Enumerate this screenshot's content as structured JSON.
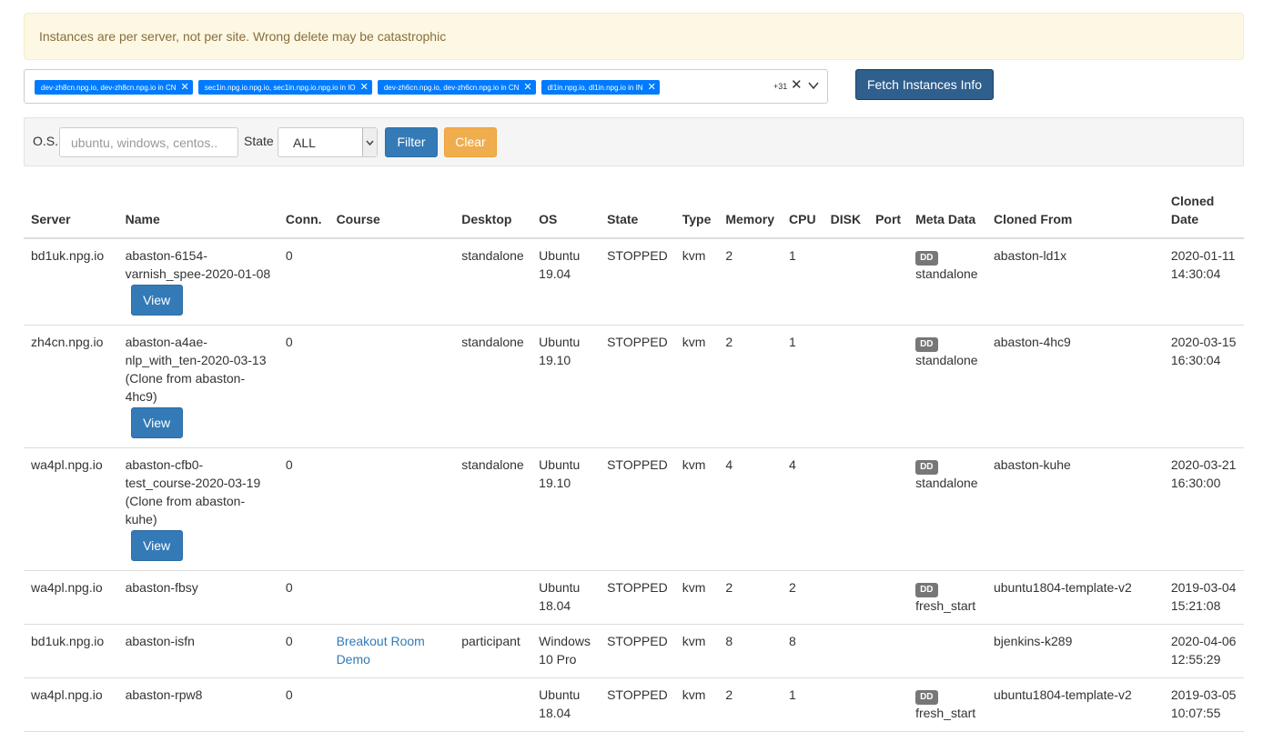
{
  "alert": {
    "warning_text": "Instances are per server, not per site. Wrong delete may be catastrophic"
  },
  "site_selector": {
    "tags": [
      "dev-zh8cn.npg.io, dev-zh8cn.npg.io in CN",
      "sec1in.npg.io.npg.io, sec1in.npg.io.npg.io in IO",
      "dev-zh6cn.npg.io, dev-zh6cn.npg.io in CN",
      "dl1in.npg.io, dl1in.npg.io in IN"
    ],
    "more_count": "+31",
    "remove_icon": "close-icon",
    "dropdown_icon": "chevron-down-icon"
  },
  "fetch_button_label": "Fetch Instances Info",
  "filters": {
    "os_label": "O.S.",
    "os_placeholder": "ubuntu, windows, centos..",
    "state_label": "State",
    "state_value": "ALL",
    "filter_label": "Filter",
    "clear_label": "Clear"
  },
  "table": {
    "headers": {
      "server": "Server",
      "name": "Name",
      "conn": "Conn.",
      "course": "Course",
      "desktop": "Desktop",
      "os": "OS",
      "state": "State",
      "type": "Type",
      "memory": "Memory",
      "cpu": "CPU",
      "disk": "DISK",
      "port": "Port",
      "meta": "Meta Data",
      "cloned_from": "Cloned From",
      "cloned_date": "Cloned Date"
    },
    "view_label": "View",
    "rows": [
      {
        "server": "bd1uk.npg.io",
        "name": "abaston-6154-varnish_spee-2020-01-08",
        "conn": "0",
        "course": "",
        "desktop": "standalone",
        "os": "Ubuntu 19.04",
        "state": "STOPPED",
        "type": "kvm",
        "memory": "2",
        "cpu": "1",
        "disk": "",
        "port": "",
        "meta_badge": "DD",
        "meta_value": "standalone",
        "cloned_from": "abaston-ld1x",
        "cloned_date": "2020-01-11 14:30:04"
      },
      {
        "server": "zh4cn.npg.io",
        "name": "abaston-a4ae-nlp_with_ten-2020-03-13 (Clone from abaston-4hc9)",
        "conn": "0",
        "course": "",
        "desktop": "standalone",
        "os": "Ubuntu 19.10",
        "state": "STOPPED",
        "type": "kvm",
        "memory": "2",
        "cpu": "1",
        "disk": "",
        "port": "",
        "meta_badge": "DD",
        "meta_value": "standalone",
        "cloned_from": "abaston-4hc9",
        "cloned_date": "2020-03-15 16:30:04"
      },
      {
        "server": "wa4pl.npg.io",
        "name": "abaston-cfb0-test_course-2020-03-19 (Clone from abaston-kuhe)",
        "conn": "0",
        "course": "",
        "desktop": "standalone",
        "os": "Ubuntu 19.10",
        "state": "STOPPED",
        "type": "kvm",
        "memory": "4",
        "cpu": "4",
        "disk": "",
        "port": "",
        "meta_badge": "DD",
        "meta_value": "standalone",
        "cloned_from": "abaston-kuhe",
        "cloned_date": "2020-03-21 16:30:00"
      },
      {
        "server": "wa4pl.npg.io",
        "name": "abaston-fbsy",
        "conn": "0",
        "course": "",
        "desktop": "",
        "os": "Ubuntu 18.04",
        "state": "STOPPED",
        "type": "kvm",
        "memory": "2",
        "cpu": "2",
        "disk": "",
        "port": "",
        "meta_badge": "DD",
        "meta_value": "fresh_start",
        "cloned_from": "ubuntu1804-template-v2",
        "cloned_date": "2019-03-04 15:21:08"
      },
      {
        "server": "bd1uk.npg.io",
        "name": "abaston-isfn",
        "conn": "0",
        "course": "Breakout Room Demo",
        "desktop": "participant",
        "os": "Windows 10 Pro",
        "state": "STOPPED",
        "type": "kvm",
        "memory": "8",
        "cpu": "8",
        "disk": "",
        "port": "",
        "meta_badge": "",
        "meta_value": "",
        "cloned_from": "bjenkins-k289",
        "cloned_date": "2020-04-06 12:55:29"
      },
      {
        "server": "wa4pl.npg.io",
        "name": "abaston-rpw8",
        "conn": "0",
        "course": "",
        "desktop": "",
        "os": "Ubuntu 18.04",
        "state": "STOPPED",
        "type": "kvm",
        "memory": "2",
        "cpu": "1",
        "disk": "",
        "port": "",
        "meta_badge": "DD",
        "meta_value": "fresh_start",
        "cloned_from": "ubuntu1804-template-v2",
        "cloned_date": "2019-03-05 10:07:55"
      }
    ]
  }
}
